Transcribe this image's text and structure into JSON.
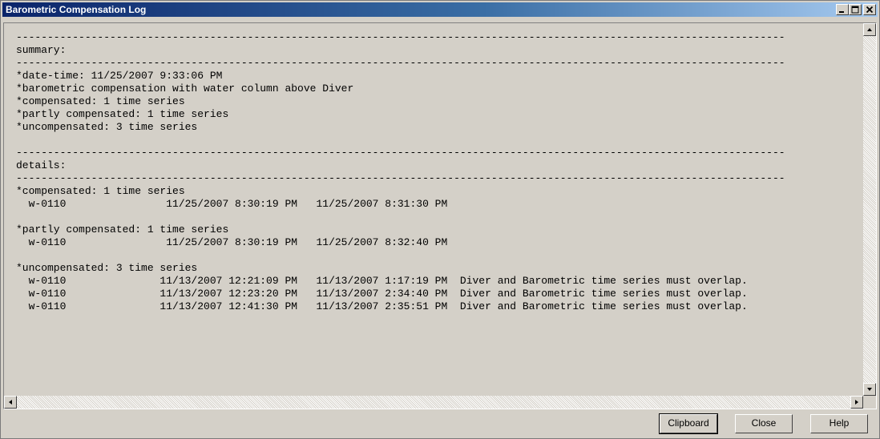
{
  "window": {
    "title": "Barometric Compensation Log"
  },
  "log": {
    "lines": [
      "---------------------------------------------------------------------------------------------------------------------------",
      "summary:",
      "---------------------------------------------------------------------------------------------------------------------------",
      "*date-time: 11/25/2007 9:33:06 PM",
      "*barometric compensation with water column above Diver",
      "*compensated: 1 time series",
      "*partly compensated: 1 time series",
      "*uncompensated: 3 time series",
      "",
      "---------------------------------------------------------------------------------------------------------------------------",
      "details:",
      "---------------------------------------------------------------------------------------------------------------------------",
      "*compensated: 1 time series",
      "  w-0110                11/25/2007 8:30:19 PM   11/25/2007 8:31:30 PM",
      "",
      "*partly compensated: 1 time series",
      "  w-0110                11/25/2007 8:30:19 PM   11/25/2007 8:32:40 PM",
      "",
      "*uncompensated: 3 time series",
      "  w-0110               11/13/2007 12:21:09 PM   11/13/2007 1:17:19 PM  Diver and Barometric time series must overlap.",
      "  w-0110               11/13/2007 12:23:20 PM   11/13/2007 2:34:40 PM  Diver and Barometric time series must overlap.",
      "  w-0110               11/13/2007 12:41:30 PM   11/13/2007 2:35:51 PM  Diver and Barometric time series must overlap."
    ]
  },
  "buttons": {
    "clipboard": "Clipboard",
    "close": "Close",
    "help": "Help"
  },
  "icons": {
    "minimize": "minimize-icon",
    "maximize": "maximize-icon",
    "close": "close-icon",
    "scroll_up": "arrow-up-icon",
    "scroll_down": "arrow-down-icon",
    "scroll_left": "arrow-left-icon",
    "scroll_right": "arrow-right-icon"
  },
  "colors": {
    "titlebar_start": "#0a246a",
    "titlebar_end": "#a6caf0",
    "face": "#d4d0c8"
  }
}
